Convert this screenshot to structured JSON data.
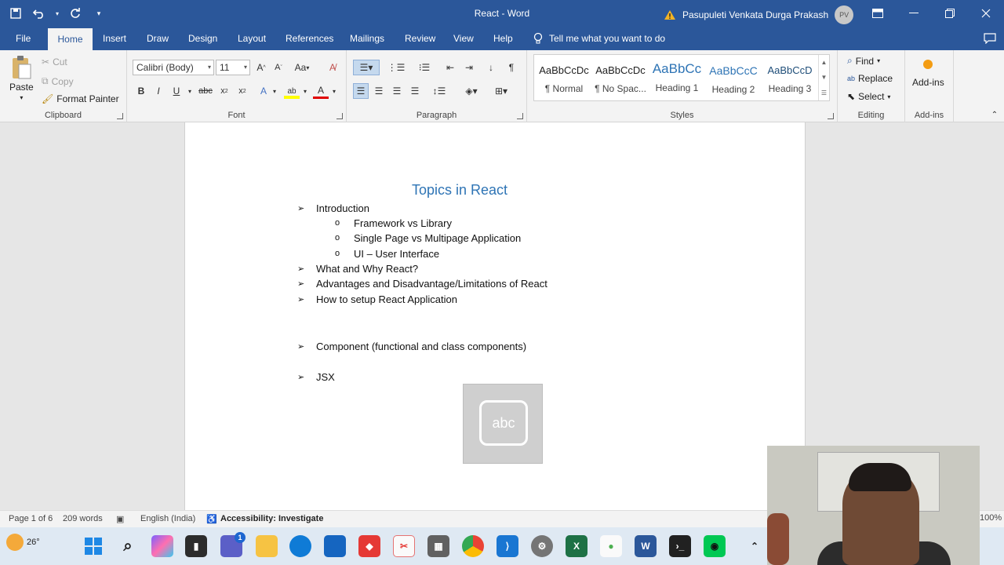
{
  "window": {
    "title": "React - Word",
    "user_name": "Pasupuleti Venkata Durga Prakash",
    "user_initials": "PV"
  },
  "tabs": [
    "File",
    "Home",
    "Insert",
    "Draw",
    "Design",
    "Layout",
    "References",
    "Mailings",
    "Review",
    "View",
    "Help"
  ],
  "tell_me": "Tell me what you want to do",
  "clipboard": {
    "paste": "Paste",
    "cut": "Cut",
    "copy": "Copy",
    "format_painter": "Format Painter",
    "label": "Clipboard"
  },
  "font": {
    "family": "Calibri (Body)",
    "size": "11",
    "label": "Font",
    "change_case": "Aa"
  },
  "paragraph": {
    "label": "Paragraph"
  },
  "styles": {
    "label": "Styles",
    "items": [
      {
        "preview": "AaBbCcDc",
        "name": "¶ Normal"
      },
      {
        "preview": "AaBbCcDc",
        "name": "¶ No Spac..."
      },
      {
        "preview": "AaBbCc",
        "name": "Heading 1"
      },
      {
        "preview": "AaBbCcC",
        "name": "Heading 2"
      },
      {
        "preview": "AaBbCcD",
        "name": "Heading 3"
      }
    ]
  },
  "editing": {
    "find": "Find",
    "replace": "Replace",
    "select": "Select",
    "label": "Editing"
  },
  "addins": {
    "button": "Add-ins",
    "label": "Add-ins"
  },
  "document": {
    "heading": "Topics in React",
    "lines": [
      {
        "level": 1,
        "text": "Introduction"
      },
      {
        "level": 2,
        "text": "Framework vs Library"
      },
      {
        "level": 2,
        "text": "Single Page vs Multipage Application"
      },
      {
        "level": 2,
        "text": "UI – User Interface"
      },
      {
        "level": 1,
        "text": "What and Why React?"
      },
      {
        "level": 1,
        "text": "Advantages and Disadvantage/Limitations of React"
      },
      {
        "level": 1,
        "text": "How to setup React Application"
      },
      {
        "level": 1,
        "text": "Component (functional and class components)"
      },
      {
        "level": 1,
        "text": "JSX"
      }
    ],
    "abc_label": "abc"
  },
  "status": {
    "page": "Page 1 of 6",
    "words": "209 words",
    "language": "English (India)",
    "accessibility": "Accessibility: Investigate",
    "zoom": "100%"
  },
  "taskbar": {
    "temperature": "26°",
    "chat_badge": "1"
  },
  "colors": {
    "accent": "#2b579a",
    "heading": "#2e74b5"
  }
}
